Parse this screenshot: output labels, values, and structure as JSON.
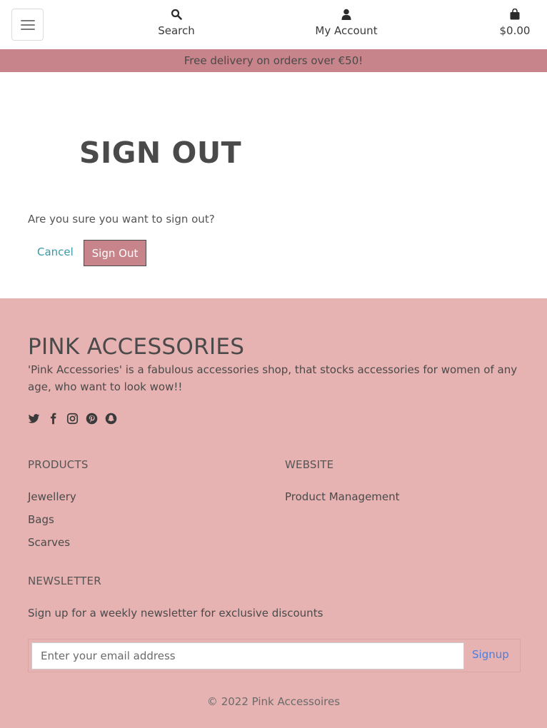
{
  "header": {
    "menu_icon": "hamburger-menu-icon",
    "search_label": "Search",
    "search_icon": "magnifier-icon",
    "account_label": "My Account",
    "account_icon": "user-icon",
    "cart_total": "$0.00",
    "cart_icon": "shopping-bag-icon"
  },
  "banner": {
    "text": "Free delivery on orders over €50!"
  },
  "main": {
    "title": "SIGN OUT",
    "question": "Are you sure you want to sign out?",
    "cancel_label": "Cancel",
    "signout_label": "Sign Out"
  },
  "footer": {
    "brand": "PINK ACCESSORIES",
    "description": "'Pink Accessories' is a fabulous accessories shop, that stocks accessories for women of any age, who want to look wow!!",
    "social_icons": [
      "twitter-icon",
      "facebook-icon",
      "instagram-icon",
      "pinterest-icon",
      "snapchat-icon"
    ],
    "products_title": "PRODUCTS",
    "products": [
      "Jewellery",
      "Bags",
      "Scarves"
    ],
    "website_title": "WEBSITE",
    "website_links": [
      "Product Management"
    ],
    "newsletter_title": "NEWSLETTER",
    "newsletter_desc": "Sign up for a weekly newsletter for exclusive discounts",
    "email_placeholder": "Enter your email address",
    "signup_label": "Signup",
    "copyright": "© 2022 Pink Accessoires"
  },
  "colors": {
    "accent": "#c7848a",
    "footer_bg": "#e7b3b2",
    "link_teal": "#3b9aa8",
    "signup_blue": "#4f7dd8"
  }
}
